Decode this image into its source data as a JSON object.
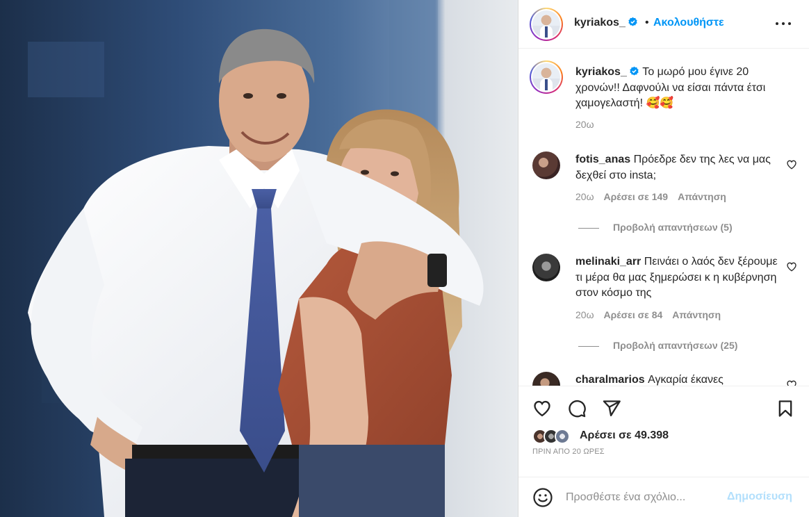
{
  "post": {
    "author": "kyriakos_",
    "follow_label": "Ακολουθήστε",
    "dot": "•",
    "caption_text": "Το μωρό μου έγινε 20 χρονών!! Δαφνούλι να είσαι πάντα έτσι χαμογελαστή! 🥰🥰",
    "caption_time": "20ω"
  },
  "comments": [
    {
      "username": "fotis_anas",
      "text": "Πρόεδρε δεν της λες να μας δεχθεί στο insta;",
      "time": "20ω",
      "likes": "Αρέσει σε 149",
      "reply": "Απάντηση",
      "view_replies": "Προβολή απαντήσεων (5)"
    },
    {
      "username": "melinaki_arr",
      "text": "Πεινάει ο λαός δεν ξέρουμε τι μέρα θα μας ξημερώσει κ η κυβέρνηση στον κόσμο της",
      "time": "20ω",
      "likes": "Αρέσει σε 84",
      "reply": "Απάντηση",
      "view_replies": "Προβολή απαντήσεων (25)"
    },
    {
      "username": "charalmarios",
      "text": "Αγκαρία έκανες"
    }
  ],
  "actions": {
    "likes_prefix": "Αρέσει σε ",
    "likes_count": "49.398",
    "time_ago": "ΠΡΙΝ ΑΠΟ 20 ΩΡΕΣ"
  },
  "add_comment": {
    "placeholder": "Προσθέστε ένα σχόλιο...",
    "post_label": "Δημοσίευση"
  },
  "icons": {
    "verified": "verified-badge-icon",
    "more": "more-options-icon",
    "like": "heart-icon",
    "comment": "comment-bubble-icon",
    "share": "paper-plane-icon",
    "save": "bookmark-icon",
    "emoji": "emoji-icon"
  },
  "colors": {
    "accent": "#0095f6",
    "muted": "#8e8e8e",
    "post_disabled": "#b2dffc"
  }
}
